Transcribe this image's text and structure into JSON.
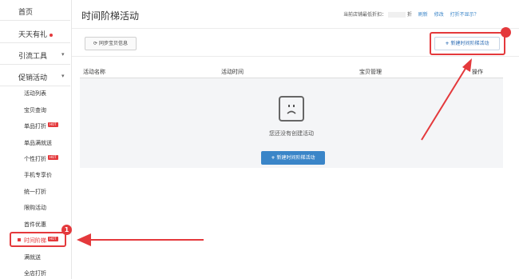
{
  "sidebar": {
    "top_items": [
      {
        "label": "首页"
      },
      {
        "label": "天天有礼"
      },
      {
        "label": "引流工具"
      },
      {
        "label": "促销活动"
      }
    ],
    "sub_items": [
      {
        "label": "活动列表"
      },
      {
        "label": "宝贝查询"
      },
      {
        "label": "单品打折",
        "hot": "HOT"
      },
      {
        "label": "单品满就送"
      },
      {
        "label": "个性打折",
        "hot": "HOT"
      },
      {
        "label": "手机专享价"
      },
      {
        "label": "统一打折"
      },
      {
        "label": "限购活动"
      },
      {
        "label": "首件优惠"
      },
      {
        "label": "时间阶梯",
        "hot": "HOT"
      },
      {
        "label": "满就送"
      },
      {
        "label": "全店打折"
      }
    ]
  },
  "header": {
    "title": "时间阶梯活动",
    "min_discount_label": "当前店铺最低折扣：",
    "min_discount_unit": "折",
    "links": [
      "刷新",
      "修改",
      "打折不显示？"
    ]
  },
  "toolbar": {
    "sync_label": "同步宝贝信息",
    "new_label": "新建时间阶梯活动"
  },
  "table": {
    "columns": [
      "活动名称",
      "活动时间",
      "宝贝管理",
      "操作"
    ],
    "empty_text": "您还没有创建活动",
    "empty_button": "新建时间阶梯活动"
  },
  "annotations": {
    "badge_1": "1"
  },
  "colors": {
    "accent": "#3a85c8",
    "highlight": "#e4393c"
  }
}
